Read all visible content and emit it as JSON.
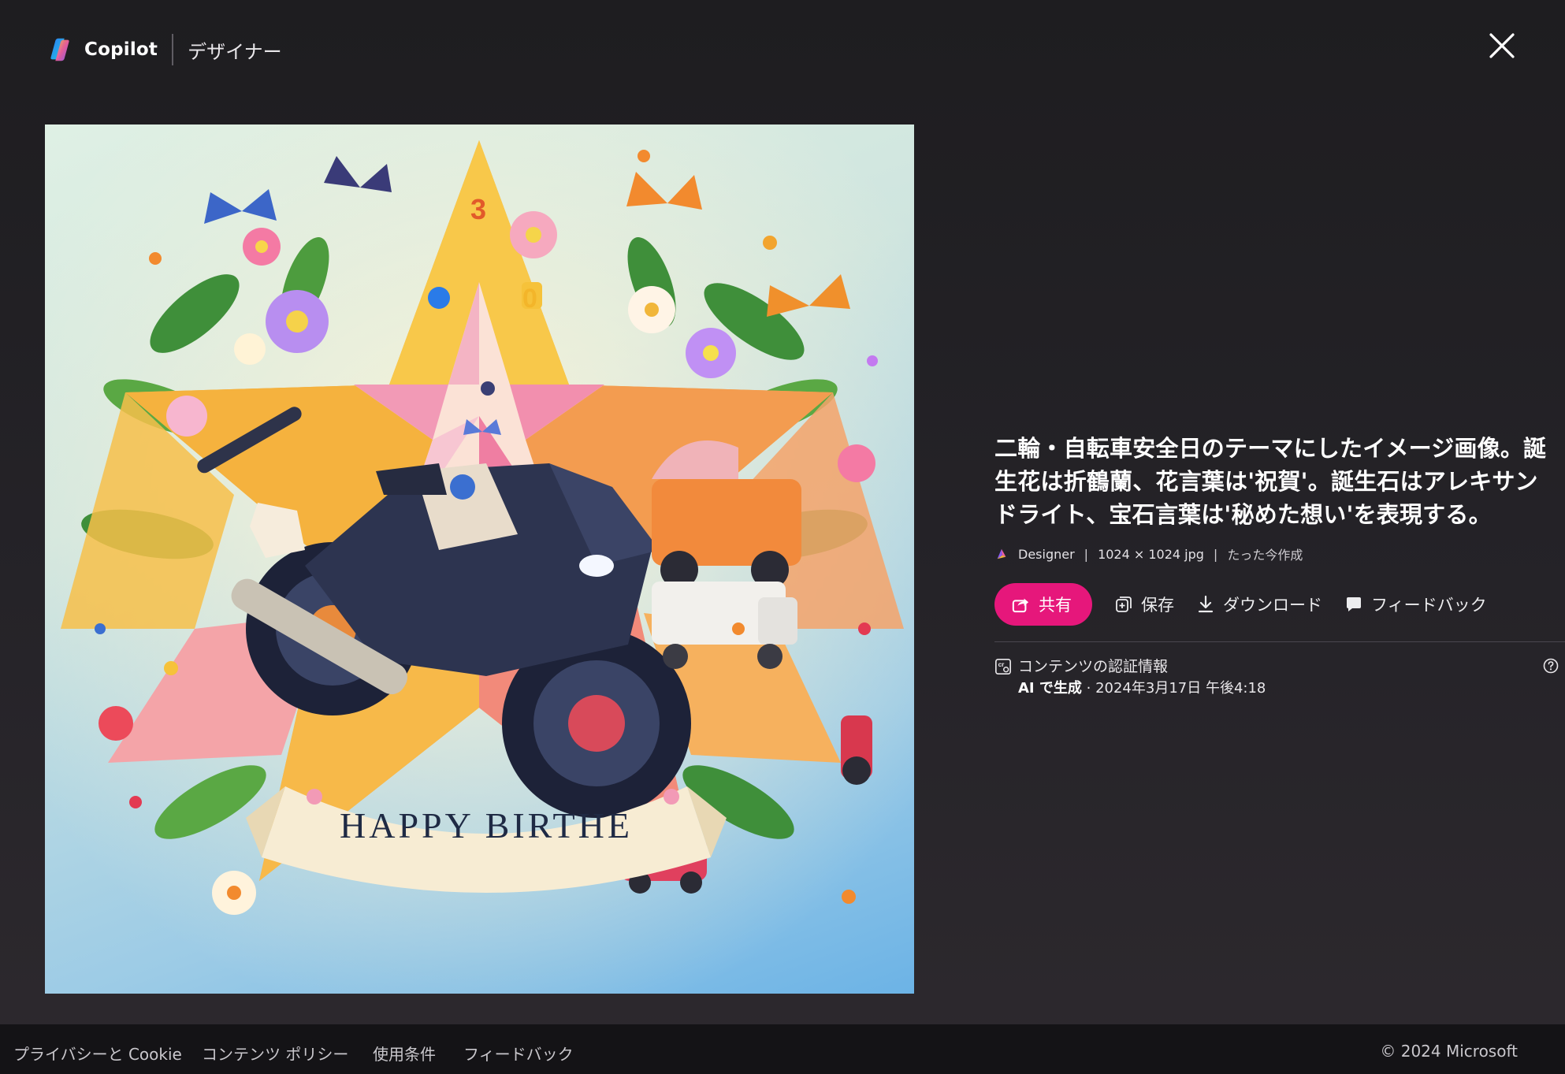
{
  "header": {
    "brand_name": "Copilot",
    "product_name": "デザイナー",
    "close_icon": "close-icon"
  },
  "artwork": {
    "banner_text": "HAPPY BIRTHE",
    "numbers": [
      "3",
      "0"
    ],
    "next_icon": "chevron-right-icon"
  },
  "details": {
    "prompt": "二輪・自転車安全日のテーマにしたイメージ画像。誕生花は折鶴蘭、花言葉は'祝賀'。誕生石はアレキサンドライト、宝石言葉は'秘めた想い'を表現する。",
    "meta": {
      "source": "Designer",
      "dimensions": "1024 × 1024 jpg",
      "created": "たった今作成",
      "separator": "|"
    },
    "actions": {
      "share": "共有",
      "save": "保存",
      "download": "ダウンロード",
      "feedback": "フィードバック"
    },
    "credentials": {
      "title": "コンテンツの認証情報",
      "generated": "AI で生成",
      "date": " · 2024年3月17日 午後4:18"
    }
  },
  "footer": {
    "links": [
      "プライバシーと Cookie",
      "コンテンツ ポリシー",
      "使用条件",
      "フィードバック"
    ],
    "copyright": "© 2024 Microsoft"
  },
  "colors": {
    "background": "#1e1d20",
    "share_button": "#e6177b",
    "footer": "#141316"
  }
}
